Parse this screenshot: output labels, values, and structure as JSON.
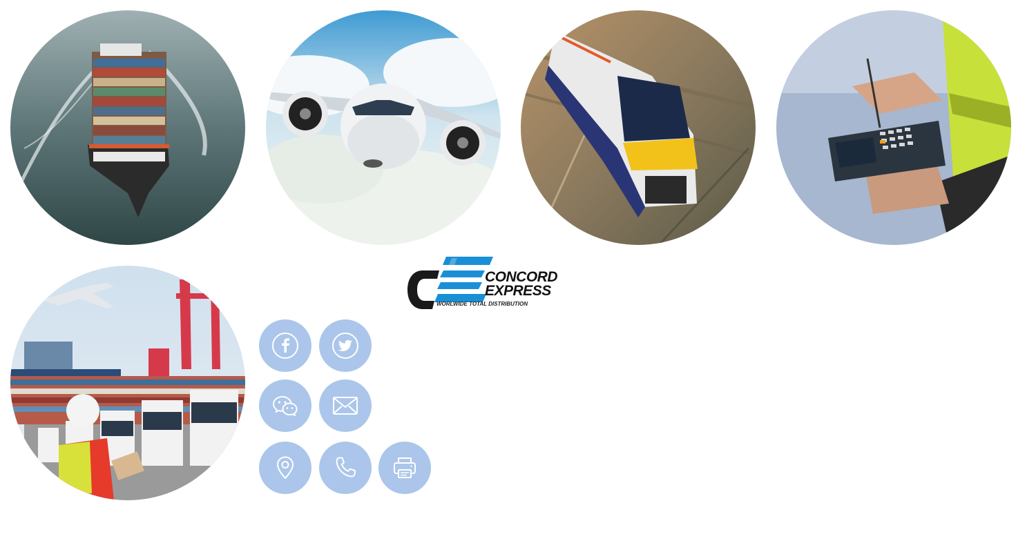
{
  "logo": {
    "line1": "CONCORD",
    "line2": "EXPRESS",
    "tagline": "WORLWIDE TOTAL DISTRIBUTION"
  },
  "brand_colors": {
    "logo_blue": "#1a8fd6",
    "logo_black": "#1a1a1a",
    "social_button_bg": "#abc6ea",
    "social_icon": "#ffffff"
  },
  "photos": [
    {
      "subject": "container ship at sea"
    },
    {
      "subject": "airplane in clouds"
    },
    {
      "subject": "high-speed train"
    },
    {
      "subject": "worker with handheld barcode scanner"
    },
    {
      "subject": "port with trucks, cranes, cargo plane and worker"
    }
  ],
  "social_links": [
    {
      "icon": "facebook-icon"
    },
    {
      "icon": "twitter-icon"
    },
    {
      "icon": "wechat-icon"
    },
    {
      "icon": "email-icon"
    },
    {
      "icon": "location-icon"
    },
    {
      "icon": "phone-icon"
    },
    {
      "icon": "fax-icon"
    }
  ]
}
